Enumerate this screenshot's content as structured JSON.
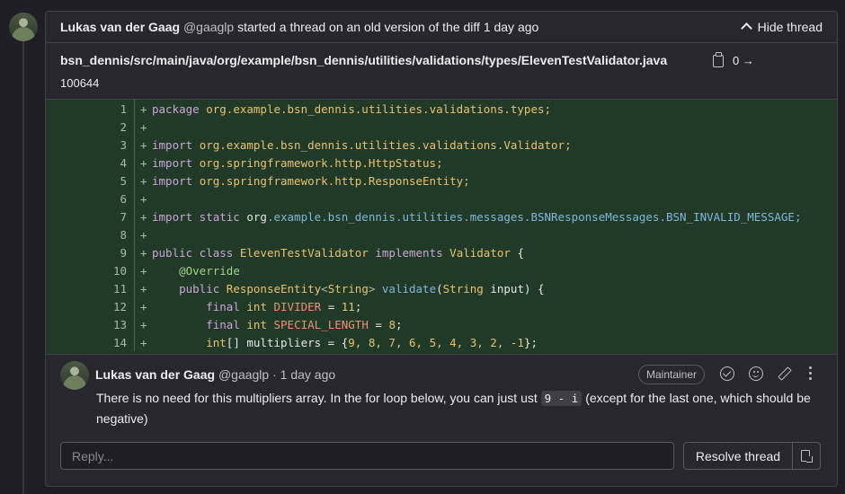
{
  "thread": {
    "author_name": "Lukas van der Gaag",
    "author_handle": "@gaaglp",
    "action_text": "started a thread on an old version of the diff",
    "time": "1 day ago",
    "hide_label": "Hide thread"
  },
  "file": {
    "path": "bsn_dennis/src/main/java/org/example/bsn_dennis/utilities/validations/types/ElevenTestValidator.java",
    "stat": "0 →",
    "mode": "100644"
  },
  "code_lines": [
    {
      "n": "1",
      "marker": "+"
    },
    {
      "n": "2",
      "marker": "+"
    },
    {
      "n": "3",
      "marker": "+"
    },
    {
      "n": "4",
      "marker": "+"
    },
    {
      "n": "5",
      "marker": "+"
    },
    {
      "n": "6",
      "marker": "+"
    },
    {
      "n": "7",
      "marker": "+"
    },
    {
      "n": "8",
      "marker": "+"
    },
    {
      "n": "9",
      "marker": "+"
    },
    {
      "n": "10",
      "marker": "+"
    },
    {
      "n": "11",
      "marker": "+"
    },
    {
      "n": "12",
      "marker": "+"
    },
    {
      "n": "13",
      "marker": "+"
    },
    {
      "n": "14",
      "marker": "+"
    }
  ],
  "code": {
    "l1_kw": "package",
    "l1_pkg": "org.example.bsn_dennis.utilities.validations.types;",
    "l3_kw": "import",
    "l3_pkg": "org.example.bsn_dennis.utilities.validations.Validator;",
    "l4_kw": "import",
    "l4_pkg": "org.springframework.http.HttpStatus;",
    "l5_kw": "import",
    "l5_pkg": "org.springframework.http.ResponseEntity;",
    "l7_kw": "import static",
    "l7_org": "org",
    "l7_rest": ".example.bsn_dennis.utilities.messages.BSNResponseMessages.BSN_INVALID_MESSAGE;",
    "l9_kw": "public class",
    "l9_name": "ElevenTestValidator",
    "l9_impl": "implements",
    "l9_iface": "Validator",
    "l9_brace": "{",
    "l10_ann": "@Override",
    "l11_kw": "public",
    "l11_type": "ResponseEntity",
    "l11_gen_open": "<",
    "l11_gen": "String",
    "l11_gen_close": ">",
    "l11_method": "validate",
    "l11_paren": "(",
    "l11_ptype": "String",
    "l11_rest": "input) {",
    "l12_kw": "final",
    "l12_type": "int",
    "l12_name": "DIVIDER",
    "l12_eq": "=",
    "l12_val": "11",
    "l12_end": ";",
    "l13_kw": "final",
    "l13_type": "int",
    "l13_name": "SPECIAL_LENGTH",
    "l13_eq": "=",
    "l13_val": "8",
    "l13_end": ";",
    "l14_type": "int",
    "l14_rest": "[] multipliers = {",
    "l14_vals": "9, 8, 7, 6, 5, 4, 3, 2, -1",
    "l14_end": "};"
  },
  "reply": {
    "author_name": "Lukas van der Gaag",
    "author_handle": "@gaaglp",
    "separator": "·",
    "time": "1 day ago",
    "badge": "Maintainer",
    "body_before": "There is no need for this multipliers array. In the for loop below, you can just ust",
    "body_code": "9 - i",
    "body_after": "(except for the last one, which should be negative)"
  },
  "footer": {
    "reply_placeholder": "Reply...",
    "resolve_label": "Resolve thread"
  }
}
